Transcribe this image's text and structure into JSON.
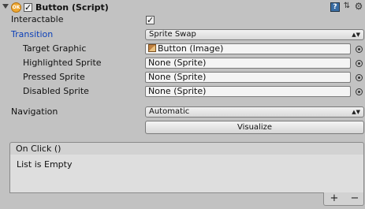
{
  "header": {
    "title": "Button (Script)",
    "enabled": true,
    "script_icon_text": "OK"
  },
  "interactable": {
    "label": "Interactable",
    "checked": true
  },
  "transition": {
    "label": "Transition",
    "value": "Sprite Swap"
  },
  "target_graphic": {
    "label": "Target Graphic",
    "value": "Button (Image)"
  },
  "highlighted_sprite": {
    "label": "Highlighted Sprite",
    "value": "None (Sprite)"
  },
  "pressed_sprite": {
    "label": "Pressed Sprite",
    "value": "None (Sprite)"
  },
  "disabled_sprite": {
    "label": "Disabled Sprite",
    "value": "None (Sprite)"
  },
  "navigation": {
    "label": "Navigation",
    "value": "Automatic"
  },
  "visualize": {
    "label": "Visualize"
  },
  "on_click": {
    "title": "On Click ()",
    "empty_text": "List is Empty",
    "add_symbol": "+",
    "remove_symbol": "−"
  },
  "icons": {
    "fold": "fold-arrow-icon",
    "script": "script-icon",
    "help": "help-icon",
    "presets": "presets-icon",
    "settings": "gear-icon",
    "object_picker": "object-picker-icon",
    "dropdown": "dropdown-arrow-icon"
  },
  "colors": {
    "background": "#c2c2c2",
    "accent_label": "#0b3fb8"
  }
}
